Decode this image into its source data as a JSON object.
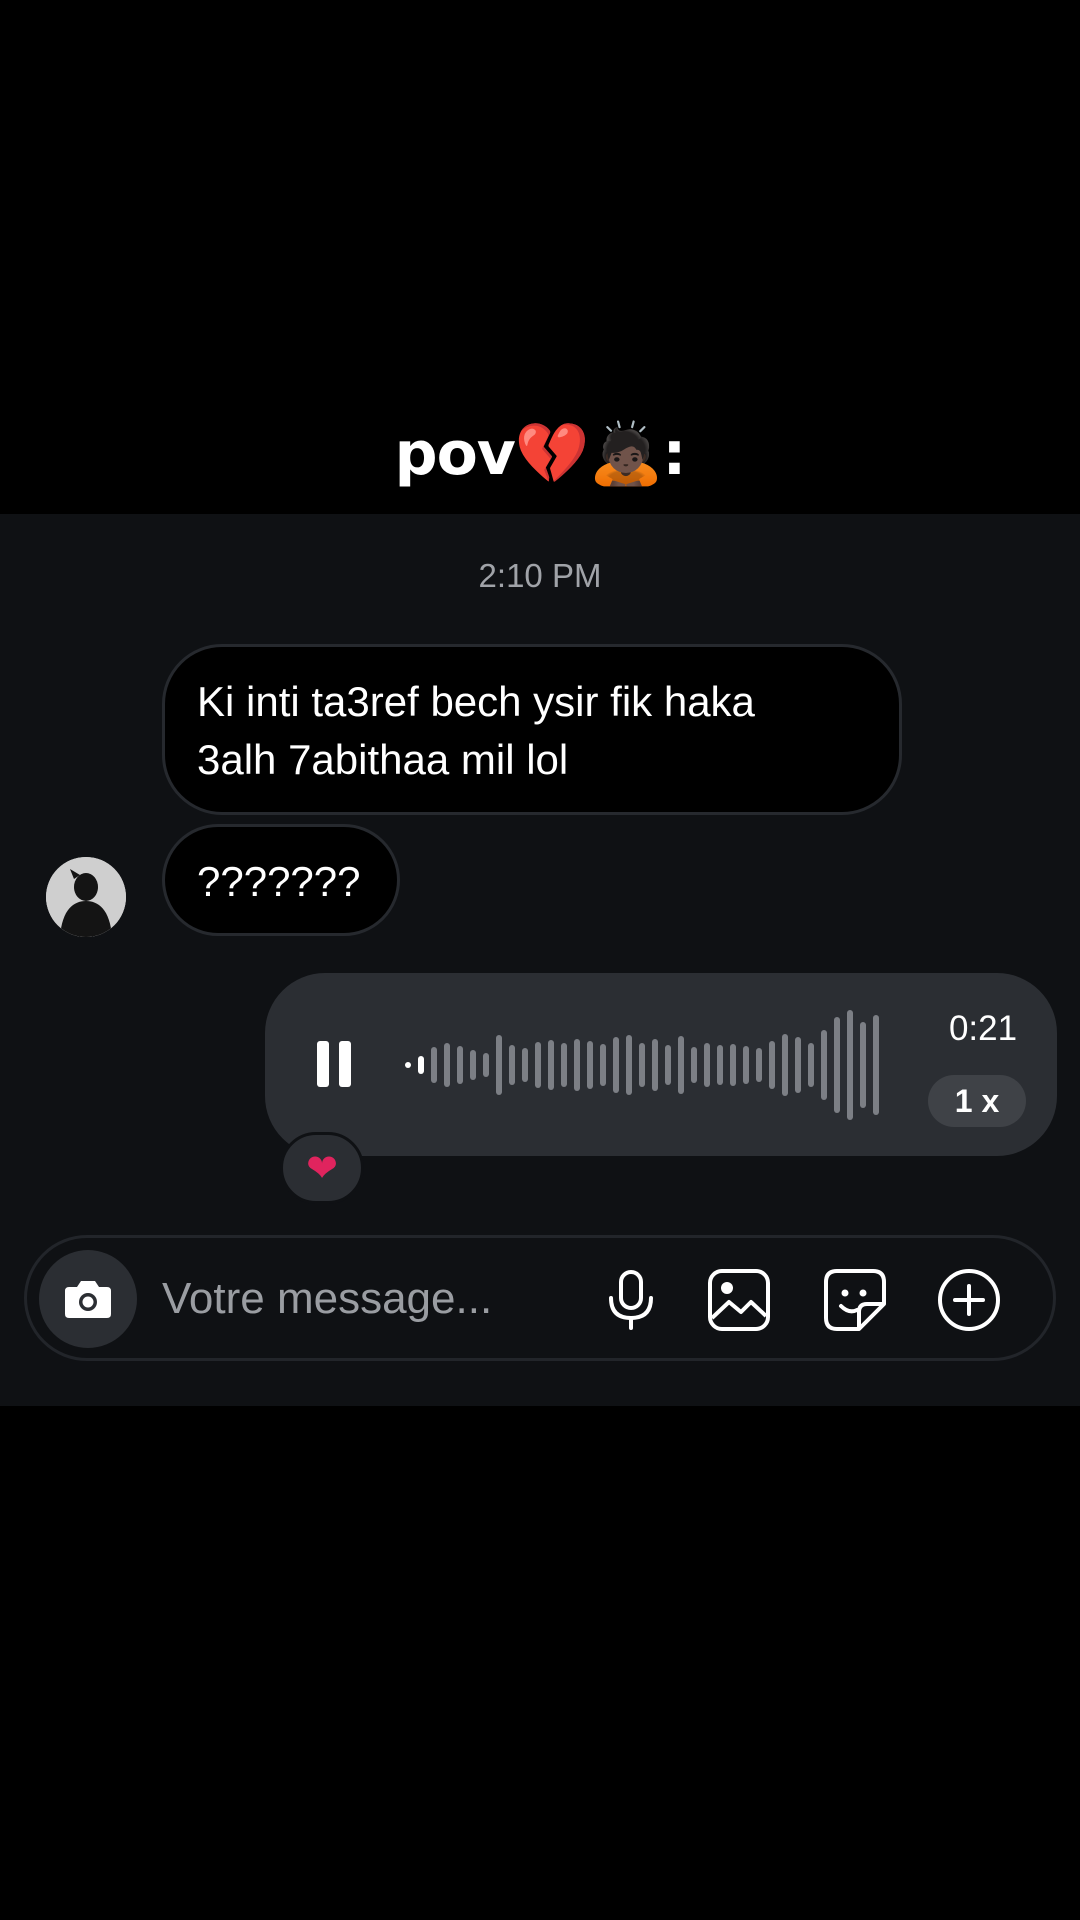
{
  "caption": {
    "text": "pov",
    "emoji_broken_heart": "💔",
    "emoji_person": "🙇🏿",
    "colon": ":"
  },
  "chat": {
    "timestamp": "2:10 PM",
    "messages": [
      {
        "line1": "Ki inti ta3ref bech ysir fik haka",
        "line2": "3alh 7abithaa mil lol"
      },
      {
        "text": "???????"
      }
    ],
    "voice_message": {
      "duration": "0:21",
      "speed": "1 x",
      "reaction": "❤"
    }
  },
  "composer": {
    "placeholder": "Votre message..."
  },
  "icons": [
    "camera-icon",
    "microphone-icon",
    "gallery-icon",
    "sticker-icon",
    "plus-circle-icon",
    "pause-icon"
  ],
  "colors": {
    "panel_bg": "#0f1114",
    "bubble_dark": "#000000",
    "voice_bubble": "#2b2e33",
    "reaction_heart": "#e0245e"
  }
}
